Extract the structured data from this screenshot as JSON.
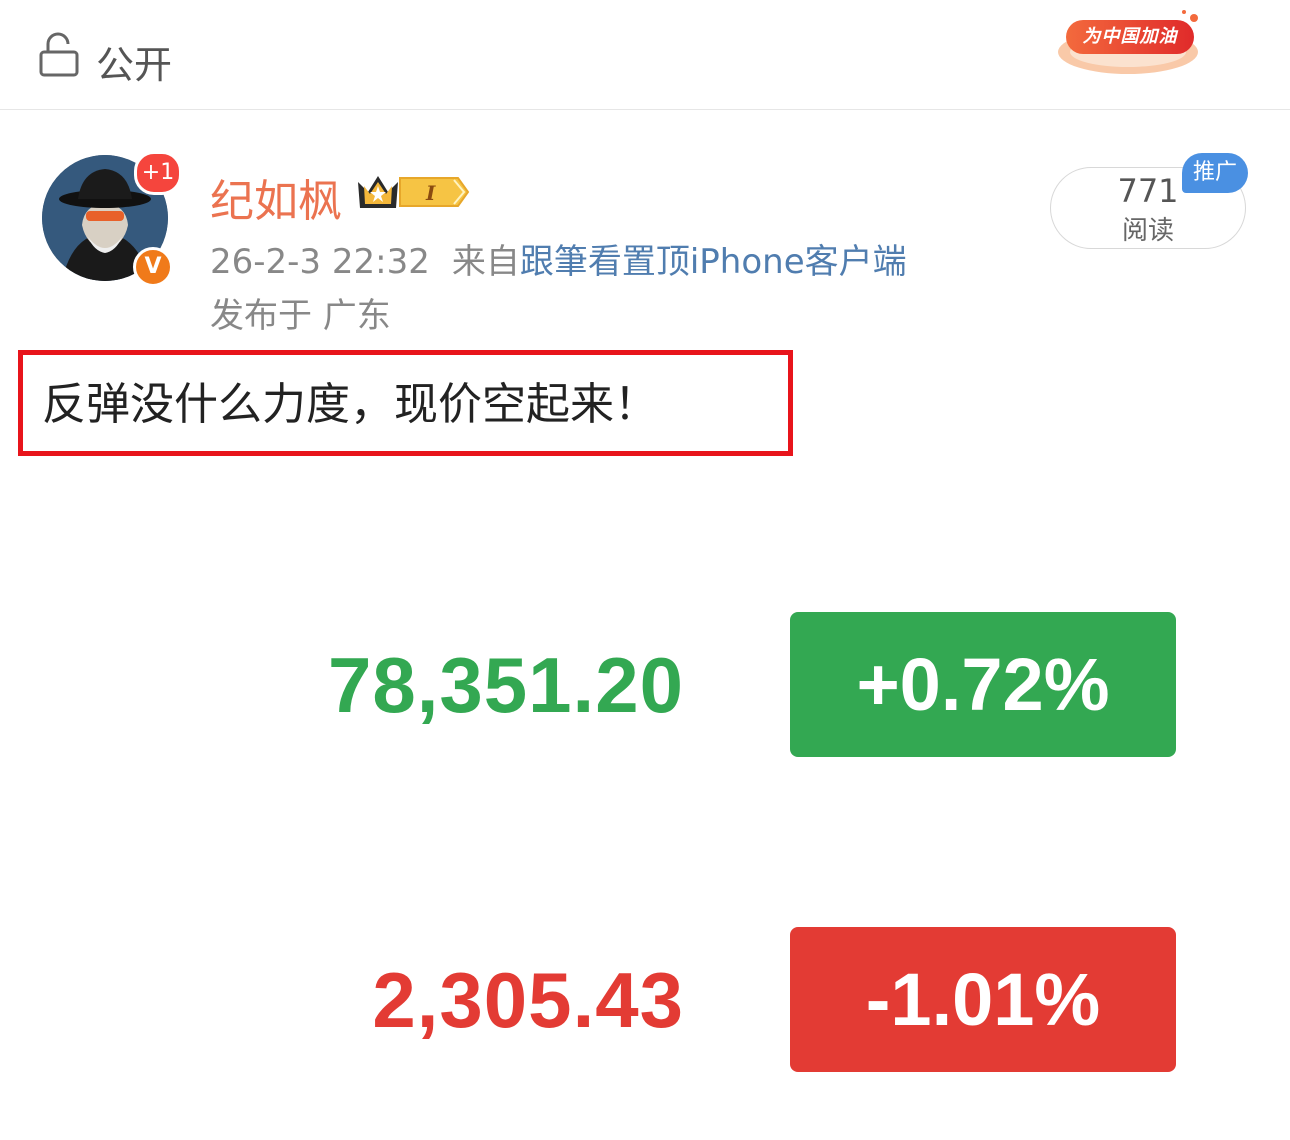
{
  "topbar": {
    "privacy_icon": "unlock-icon",
    "privacy_label": "公开",
    "event_badge_text": "为中国加油"
  },
  "author": {
    "name": "纪如枫",
    "plus_badge": "+1",
    "verified_mark": "V",
    "level_badge": "I"
  },
  "meta": {
    "datetime": "26-2-3 22:32",
    "source_prefix": "来自",
    "source": "跟筆看置顶iPhone客户端",
    "location": "发布于 广东"
  },
  "reads": {
    "count": "771",
    "label": "阅读",
    "promo_tag": "推广"
  },
  "post": {
    "text": "反弹没什么力度，现价空起来！"
  },
  "market": {
    "rows": [
      {
        "value": "78,351.20",
        "change": "+0.72%",
        "direction": "up"
      },
      {
        "value": "2,305.43",
        "change": "-1.01%",
        "direction": "down"
      }
    ]
  },
  "colors": {
    "up": "#33a852",
    "down": "#e33b34",
    "highlight": "#e8141b",
    "username": "#eb7350",
    "link": "#507daf"
  }
}
